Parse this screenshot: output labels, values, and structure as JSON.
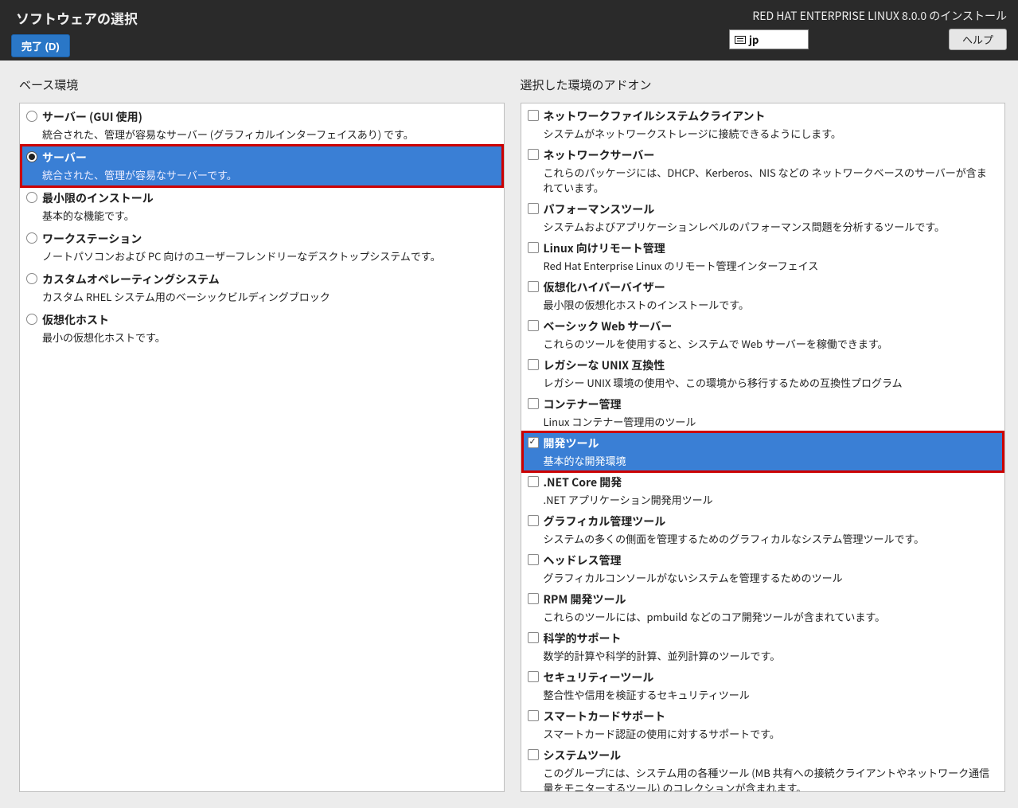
{
  "header": {
    "title": "ソフトウェアの選択",
    "install_title": "RED HAT ENTERPRISE LINUX 8.0.0 のインストール",
    "done_btn": "完了 (D)",
    "keyboard_layout": "jp",
    "help_btn": "ヘルプ"
  },
  "columns": {
    "base_env_title": "ベース環境",
    "addons_title": "選択した環境のアドオン"
  },
  "base_envs": [
    {
      "label": "サーバー (GUI 使用)",
      "desc": "統合された、管理が容易なサーバー (グラフィカルインターフェイスあり) です。",
      "selected": false
    },
    {
      "label": "サーバー",
      "desc": "統合された、管理が容易なサーバーです。",
      "selected": true,
      "highlighted": true
    },
    {
      "label": "最小限のインストール",
      "desc": "基本的な機能です。",
      "selected": false
    },
    {
      "label": "ワークステーション",
      "desc": "ノートパソコンおよび PC 向けのユーザーフレンドリーなデスクトップシステムです。",
      "selected": false
    },
    {
      "label": "カスタムオペレーティングシステム",
      "desc": "カスタム RHEL システム用のベーシックビルディングブロック",
      "selected": false
    },
    {
      "label": "仮想化ホスト",
      "desc": "最小の仮想化ホストです。",
      "selected": false
    }
  ],
  "addons": [
    {
      "label": "ネットワークファイルシステムクライアント",
      "desc": "システムがネットワークストレージに接続できるようにします。",
      "checked": false
    },
    {
      "label": "ネットワークサーバー",
      "desc": "これらのパッケージには、DHCP、Kerberos、NIS などの ネットワークベースのサーバーが含まれています。",
      "checked": false
    },
    {
      "label": "パフォーマンスツール",
      "desc": "システムおよびアプリケーションレベルのパフォーマンス問題を分析するツールです。",
      "checked": false
    },
    {
      "label": "Linux 向けリモート管理",
      "desc": "Red Hat Enterprise Linux のリモート管理インターフェイス",
      "checked": false
    },
    {
      "label": "仮想化ハイパーバイザー",
      "desc": "最小限の仮想化ホストのインストールです。",
      "checked": false
    },
    {
      "label": "ベーシック Web サーバー",
      "desc": "これらのツールを使用すると、システムで Web サーバーを稼働できます。",
      "checked": false
    },
    {
      "label": "レガシーな UNIX 互換性",
      "desc": "レガシー UNIX 環境の使用や、この環境から移行するための互換性プログラム",
      "checked": false
    },
    {
      "label": "コンテナー管理",
      "desc": "Linux コンテナー管理用のツール",
      "checked": false
    },
    {
      "label": "開発ツール",
      "desc": "基本的な開発環境",
      "checked": true,
      "selected": true,
      "highlighted": true
    },
    {
      "label": ".NET Core 開発",
      "desc": ".NET アプリケーション開発用ツール",
      "checked": false
    },
    {
      "label": "グラフィカル管理ツール",
      "desc": "システムの多くの側面を管理するためのグラフィカルなシステム管理ツールです。",
      "checked": false
    },
    {
      "label": "ヘッドレス管理",
      "desc": "グラフィカルコンソールがないシステムを管理するためのツール",
      "checked": false
    },
    {
      "label": "RPM 開発ツール",
      "desc": "これらのツールには、pmbuild などのコア開発ツールが含まれています。",
      "checked": false
    },
    {
      "label": "科学的サポート",
      "desc": "数学的計算や科学的計算、並列計算のツールです。",
      "checked": false
    },
    {
      "label": "セキュリティーツール",
      "desc": "整合性や信用を検証するセキュリティツール",
      "checked": false
    },
    {
      "label": "スマートカードサポート",
      "desc": "スマートカード認証の使用に対するサポートです。",
      "checked": false
    },
    {
      "label": "システムツール",
      "desc": "このグループには、システム用の各種ツール (MB 共有への接続クライアントやネットワーク通信量をモニターするツール) のコレクションが含まれます。",
      "checked": false
    }
  ]
}
